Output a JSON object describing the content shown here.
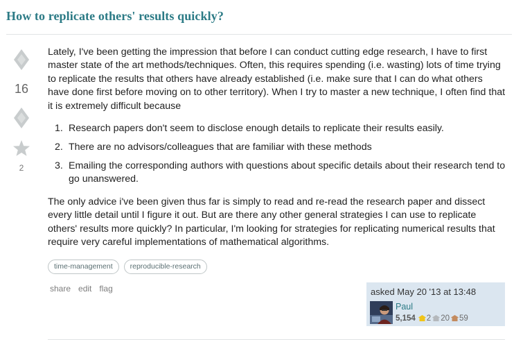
{
  "question": {
    "title": "How to replicate others' results quickly?",
    "votes": "16",
    "favorites": "2",
    "intro": "Lately, I've been getting the impression that before I can conduct cutting edge research, I have to first master state of the art methods/techniques. Often, this requires spending (i.e. wasting) lots of time trying to replicate the results that others have already established (i.e. make sure that I can do what others have done first before moving on to other territory). When I try to master a new technique, I often find that it is extremely difficult because",
    "list": [
      {
        "num": "1.",
        "text": "Research papers don't seem to disclose enough details to replicate their results easily."
      },
      {
        "num": "2.",
        "text": "There are no advisors/colleagues that are familiar with these methods"
      },
      {
        "num": "3.",
        "text": "Emailing the corresponding authors with questions about specific details about their research tend to go unanswered."
      }
    ],
    "closing": "The only advice i've been given thus far is simply to read and re-read the research paper and dissect every little detail until I figure it out. But are there any other general strategies I can use to replicate others' results more quickly? In particular, I'm looking for strategies for replicating numerical results that require very careful implementations of mathematical algorithms.",
    "tags": [
      "time-management",
      "reproducible-research"
    ]
  },
  "post_menu": {
    "share": "share",
    "edit": "edit",
    "flag": "flag"
  },
  "signature": {
    "asked": "asked May 20 '13 at 13:48",
    "user_name": "Paul",
    "reputation": "5,154",
    "gold": "2",
    "silver": "20",
    "bronze": "59"
  },
  "colors": {
    "title": "#2b7a85",
    "signature_bg": "#dbe6f0",
    "vote_icon": "#c8cccd",
    "gold": "#f0c419",
    "silver": "#b4b8bc",
    "bronze": "#c38b5f"
  }
}
